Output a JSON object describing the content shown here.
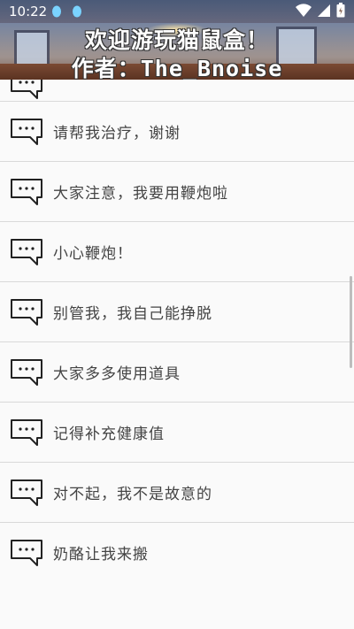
{
  "status_bar": {
    "time": "10:22"
  },
  "banner": {
    "line1": "欢迎游玩猫鼠盒！",
    "line2": "作者：The_Bnoise"
  },
  "list": {
    "items": [
      {
        "label": "请帮我治疗，谢谢"
      },
      {
        "label": "大家注意，我要用鞭炮啦"
      },
      {
        "label": "小心鞭炮！"
      },
      {
        "label": "别管我，我自己能挣脱"
      },
      {
        "label": "大家多多使用道具"
      },
      {
        "label": "记得补充健康值"
      },
      {
        "label": "对不起，我不是故意的"
      },
      {
        "label": "奶酪让我来搬"
      }
    ]
  }
}
